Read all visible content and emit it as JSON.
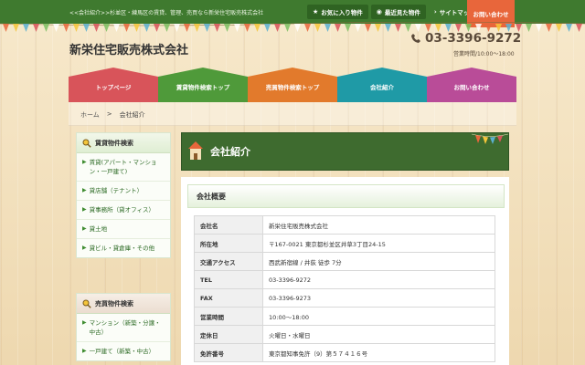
{
  "topbar": {
    "tagline": "<<会社紹介>>杉並区・練馬区の賃貸、管理、売買なら新栄住宅販売株式会社",
    "links": [
      {
        "label": "お気に入り物件",
        "icon": "star-icon"
      },
      {
        "label": "最近見た物件",
        "icon": "eye-icon"
      },
      {
        "label": "サイトマップ",
        "icon": "chevron-right-icon"
      }
    ],
    "contact_label": "お問い合わせ"
  },
  "header": {
    "site_title": "新栄住宅販売株式会社",
    "phone": "03-3396-9272",
    "hours": "営業時間/10:00～18:00"
  },
  "nav": {
    "items": [
      {
        "label": "トップページ",
        "color": "#d8545a"
      },
      {
        "label": "賃貸物件検索トップ",
        "color": "#4f9a3a"
      },
      {
        "label": "売買物件検索トップ",
        "color": "#e27a2c"
      },
      {
        "label": "会社紹介",
        "color": "#1f9aa6"
      },
      {
        "label": "お問い合わせ",
        "color": "#b94c98"
      }
    ]
  },
  "breadcrumb": {
    "home": "ホーム",
    "separator": ">",
    "current": "会社紹介"
  },
  "sidebar": {
    "rental": {
      "title": "賃貸物件検索",
      "items": [
        "賃貸(アパート・マンション・一戸建て)",
        "貸店舗（テナント）",
        "貸事務所（貸オフィス）",
        "貸土地",
        "貸ビル・貸倉庫・その他"
      ]
    },
    "sale": {
      "title": "売買物件検索",
      "items": [
        "マンション（新築・分譲・中古）",
        "一戸建て（新築・中古）"
      ]
    }
  },
  "main": {
    "page_title": "会社紹介",
    "section_title": "会社概要",
    "company_info": [
      {
        "key": "会社名",
        "value": "新栄住宅販売株式会社"
      },
      {
        "key": "所在地",
        "value": "〒167-0021 東京都杉並区井草3丁目24-15"
      },
      {
        "key": "交通アクセス",
        "value": "西武新宿線 / 井荻 徒歩 7分"
      },
      {
        "key": "TEL",
        "value": "03-3396-9272"
      },
      {
        "key": "FAX",
        "value": "03-3396-9273"
      },
      {
        "key": "営業時間",
        "value": "10:00～18:00"
      },
      {
        "key": "定休日",
        "value": "火曜日・水曜日"
      },
      {
        "key": "免許番号",
        "value": "東京都知事免許（9）第５７４１６号"
      }
    ]
  },
  "colors": {
    "topbar": "#3f7a2f",
    "contact": "#e8663b",
    "banner": "#3e6b2f",
    "link_green": "#2d6b25"
  }
}
